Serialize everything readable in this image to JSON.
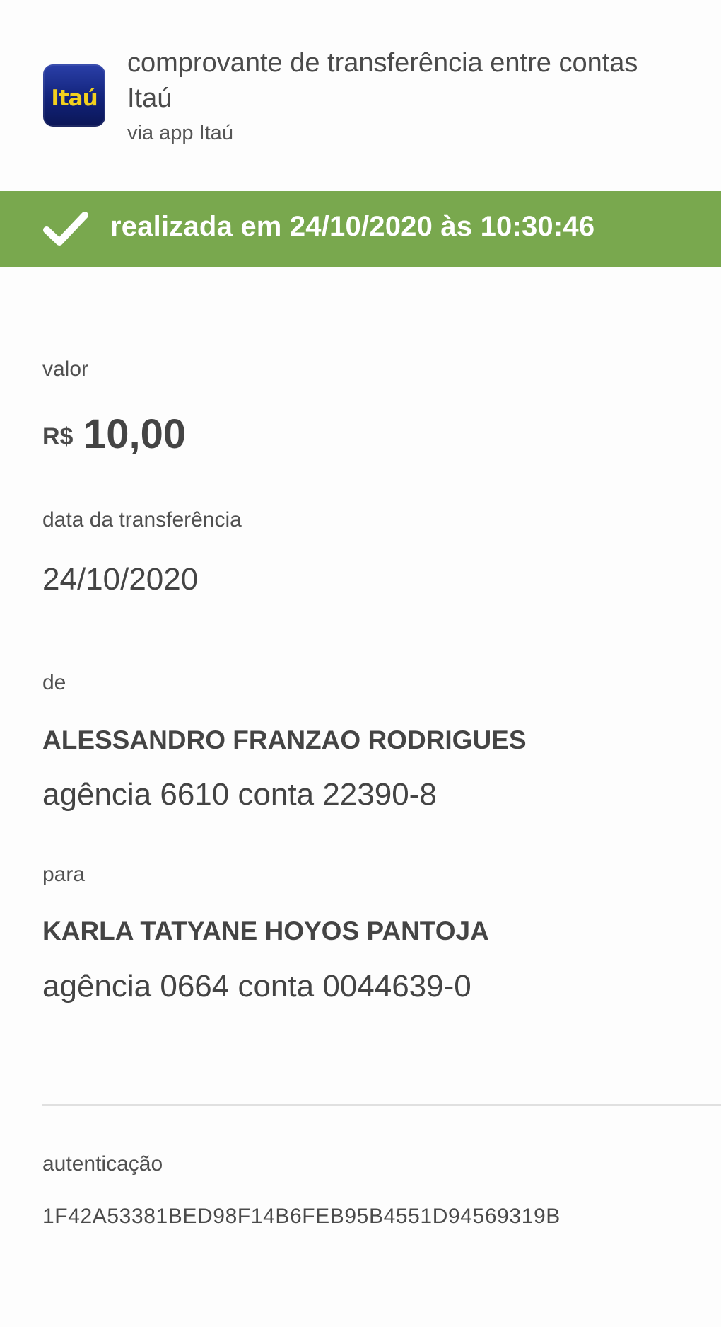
{
  "header": {
    "logo_text": "Itaú",
    "title": "comprovante de transferência entre contas Itaú",
    "subtitle": "via app Itaú"
  },
  "status": {
    "text": "realizada em 24/10/2020 às 10:30:46",
    "icon": "check-icon",
    "color": "#79a84e"
  },
  "valor": {
    "label": "valor",
    "currency": "R$",
    "amount": "10,00"
  },
  "data_transferencia": {
    "label": "data da transferência",
    "value": "24/10/2020"
  },
  "de": {
    "label": "de",
    "name": "ALESSANDRO FRANZAO RODRIGUES",
    "account": "agência 6610 conta 22390-8"
  },
  "para": {
    "label": "para",
    "name": "KARLA TATYANE HOYOS PANTOJA",
    "account": "agência 0664 conta 0044639-0"
  },
  "autenticacao": {
    "label": "autenticação",
    "code": "1F42A53381BED98F14B6FEB95B4551D94569319B"
  },
  "colors": {
    "logo_bg": "#12237a",
    "logo_text": "#f3d11e",
    "text": "#444444"
  }
}
